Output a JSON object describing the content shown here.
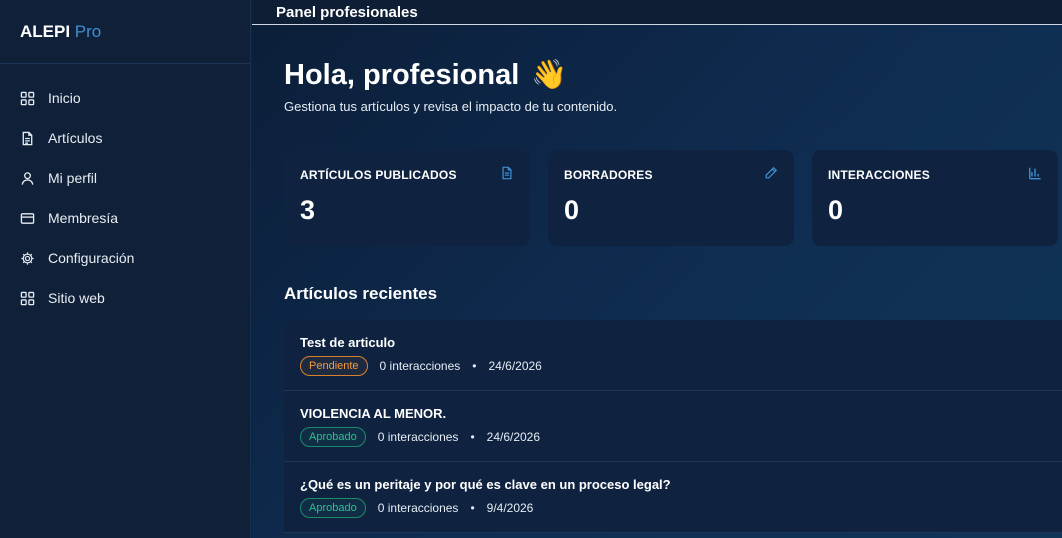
{
  "brand": {
    "name": "ALEPI",
    "suffix": "Pro"
  },
  "sidebar": {
    "items": [
      {
        "label": "Inicio",
        "icon": "grid-icon"
      },
      {
        "label": "Artículos",
        "icon": "document-icon"
      },
      {
        "label": "Mi perfil",
        "icon": "user-icon"
      },
      {
        "label": "Membresía",
        "icon": "credit-card-icon"
      },
      {
        "label": "Configuración",
        "icon": "gear-icon"
      },
      {
        "label": "Sitio web",
        "icon": "grid-icon"
      }
    ]
  },
  "header": {
    "title": "Panel profesionales"
  },
  "welcome": {
    "greeting": "Hola, profesional",
    "emoji": "👋",
    "subtitle": "Gestiona tus artículos y revisa el impacto de tu contenido."
  },
  "stats": [
    {
      "label": "ARTÍCULOS PUBLICADOS",
      "value": "3",
      "icon": "document-icon"
    },
    {
      "label": "BORRADORES",
      "value": "0",
      "icon": "pencil-icon"
    },
    {
      "label": "INTERACCIONES",
      "value": "0",
      "icon": "bar-chart-icon"
    }
  ],
  "recent": {
    "title": "Artículos recientes",
    "items": [
      {
        "title": "Test de articulo",
        "status": "Pendiente",
        "interactions": "0 interacciones",
        "date": "24/6/2026"
      },
      {
        "title": "VIOLENCIA AL MENOR.",
        "status": "Aprobado",
        "interactions": "0 interacciones",
        "date": "24/6/2026"
      },
      {
        "title": "¿Qué es un peritaje y por qué es clave en un proceso legal?",
        "status": "Aprobado",
        "interactions": "0 interacciones",
        "date": "9/4/2026"
      }
    ]
  },
  "colors": {
    "sidebar_bg": "#0f2038",
    "card_bg": "#0f2341",
    "accent": "#3f8fd2",
    "pending": "#f29a43",
    "approved": "#2cc18f"
  }
}
